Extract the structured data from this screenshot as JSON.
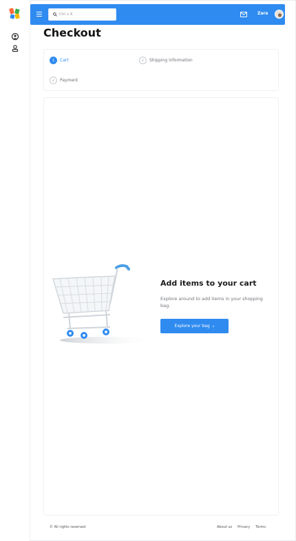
{
  "header": {
    "search_placeholder": "Ctrl + K",
    "username": "Zara"
  },
  "page": {
    "title": "Checkout"
  },
  "steps": [
    {
      "index": "1",
      "label": "Cart",
      "state": "active"
    },
    {
      "index": "√",
      "label": "Shipping information",
      "state": "pending"
    },
    {
      "index": "√",
      "label": "Payment",
      "state": "pending"
    }
  ],
  "empty_cart": {
    "title": "Add items to your cart",
    "description": "Explore around to add items in your shopping bag.",
    "button_label": "Explore your bag",
    "button_icon": "chevron-right-icon"
  },
  "footer": {
    "copyright": "© All rights reserved",
    "links": [
      "About us",
      "Privacy",
      "Terms"
    ]
  },
  "colors": {
    "primary": "#2f8bf0",
    "text_dark": "#141414",
    "muted": "#6a6e75"
  }
}
